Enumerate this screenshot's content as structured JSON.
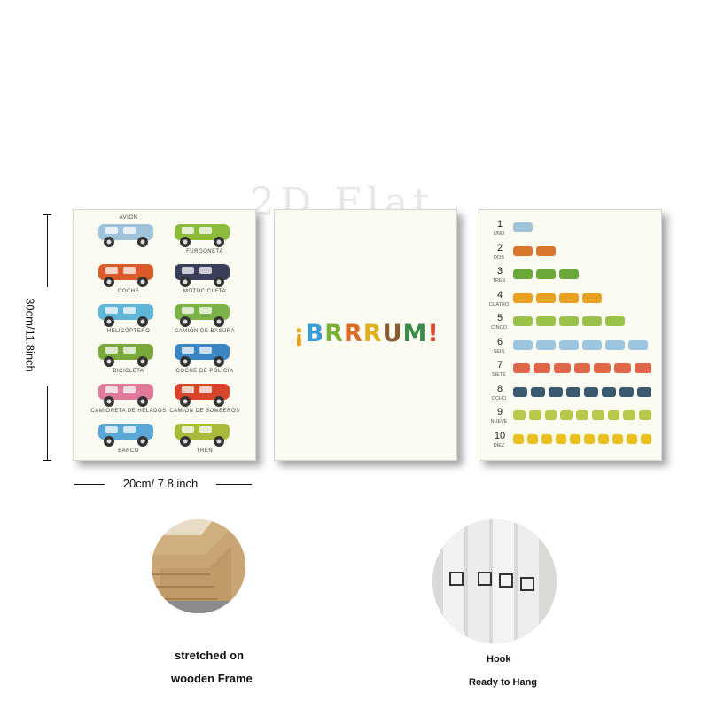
{
  "watermark": "2D Flat",
  "dimensions": {
    "height_label": "30cm/11.8inch",
    "width_label": "20cm/ 7.8 inch"
  },
  "left_poster": {
    "items": [
      {
        "label": "AVIÓN",
        "icon": "airplane-icon",
        "color": "#9fc3da"
      },
      {
        "label": "FURGONETA",
        "icon": "van-icon",
        "color": "#8dbb3c"
      },
      {
        "label": "COCHE",
        "icon": "car-icon",
        "color": "#d95a2b"
      },
      {
        "label": "MOTOCICLETA",
        "icon": "motorcycle-icon",
        "color": "#3b3f57"
      },
      {
        "label": "HELICÓPTERO",
        "icon": "helicopter-icon",
        "color": "#5fb6d8"
      },
      {
        "label": "CAMIÓN DE BASURA",
        "icon": "garbage-truck-icon",
        "color": "#7bb34a"
      },
      {
        "label": "BICICLETA",
        "icon": "bicycle-icon",
        "color": "#7aa83b"
      },
      {
        "label": "COCHE DE POLICÍA",
        "icon": "police-car-icon",
        "color": "#3a85c2"
      },
      {
        "label": "CAMIONETA DE HELADOS",
        "icon": "ice-cream-truck-icon",
        "color": "#e07a9a"
      },
      {
        "label": "CAMIÓN DE BOMBEROS",
        "icon": "fire-truck-icon",
        "color": "#d8452a"
      },
      {
        "label": "BARCO",
        "icon": "boat-icon",
        "color": "#5aa7d6"
      },
      {
        "label": "TREN",
        "icon": "train-icon",
        "color": "#a9b93a"
      }
    ]
  },
  "middle_poster": {
    "letters": [
      {
        "char": "¡",
        "color": "#e8a020"
      },
      {
        "char": "B",
        "color": "#3c9bd6"
      },
      {
        "char": "R",
        "color": "#7ab03a"
      },
      {
        "char": "R",
        "color": "#d96a2a"
      },
      {
        "char": "R",
        "color": "#e0b020"
      },
      {
        "char": "U",
        "color": "#8a5a32"
      },
      {
        "char": "M",
        "color": "#3b8a4a"
      },
      {
        "char": "!",
        "color": "#d8452a"
      }
    ]
  },
  "right_poster": {
    "rows": [
      {
        "num": "1",
        "word": "UNO",
        "color": "#9fc3da"
      },
      {
        "num": "2",
        "word": "DOS",
        "color": "#d9762b"
      },
      {
        "num": "3",
        "word": "TRES",
        "color": "#6aa83b"
      },
      {
        "num": "4",
        "word": "CUATRO",
        "color": "#e8a020"
      },
      {
        "num": "5",
        "word": "CINCO",
        "color": "#9ac24a"
      },
      {
        "num": "6",
        "word": "SEIS",
        "color": "#9cc6e0"
      },
      {
        "num": "7",
        "word": "SIETE",
        "color": "#e0684a"
      },
      {
        "num": "8",
        "word": "OCHO",
        "color": "#3b5a70"
      },
      {
        "num": "9",
        "word": "NUEVE",
        "color": "#b8c84a"
      },
      {
        "num": "10",
        "word": "DIEZ",
        "color": "#e8c020"
      }
    ]
  },
  "features": {
    "frame_caption_line1": "stretched on",
    "frame_caption_line2": "wooden Frame",
    "hook_caption_line1": "Hook",
    "hook_caption_line2": "Ready to Hang"
  }
}
